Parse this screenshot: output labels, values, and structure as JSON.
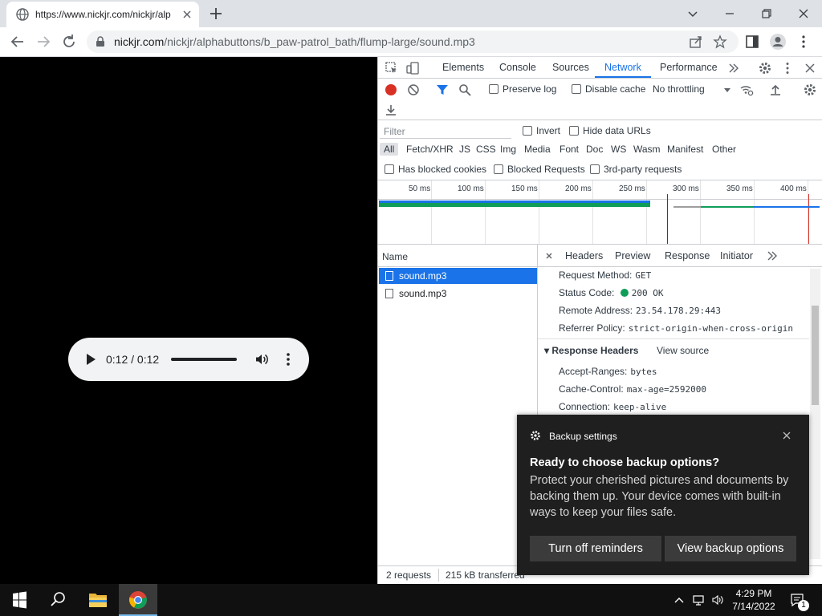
{
  "browser": {
    "tab_title": "https://www.nickjr.com/nickjr/alp",
    "url_host": "nickjr.com",
    "url_path": "/nickjr/alphabuttons/b_paw-patrol_bath/flump-large/sound.mp3"
  },
  "player": {
    "time": "0:12 / 0:12",
    "progress": 1.0
  },
  "devtools": {
    "tabs": [
      "Elements",
      "Console",
      "Sources",
      "Network",
      "Performance"
    ],
    "active_tab": "Network",
    "toolbar": {
      "preserve_log": "Preserve log",
      "disable_cache": "Disable cache",
      "throttling": "No throttling"
    },
    "filter": {
      "placeholder": "Filter",
      "invert": "Invert",
      "hide_data_urls": "Hide data URLs",
      "types": [
        "All",
        "Fetch/XHR",
        "JS",
        "CSS",
        "Img",
        "Media",
        "Font",
        "Doc",
        "WS",
        "Wasm",
        "Manifest",
        "Other"
      ],
      "has_blocked_cookies": "Has blocked cookies",
      "blocked_requests": "Blocked Requests",
      "third_party": "3rd-party requests"
    },
    "overview_ticks": [
      "50 ms",
      "100 ms",
      "150 ms",
      "200 ms",
      "250 ms",
      "300 ms",
      "350 ms",
      "400 ms"
    ],
    "requests": {
      "column": "Name",
      "rows": [
        "sound.mp3",
        "sound.mp3"
      ]
    },
    "details": {
      "tabs": [
        "Headers",
        "Preview",
        "Response",
        "Initiator"
      ],
      "request_method_key": "Request Method:",
      "request_method": "GET",
      "status_code_key": "Status Code:",
      "status_code": "200 OK",
      "remote_address_key": "Remote Address:",
      "remote_address": "23.54.178.29:443",
      "referrer_policy_key": "Referrer Policy:",
      "referrer_policy": "strict-origin-when-cross-origin",
      "response_headers": "Response Headers",
      "view_source": "View source",
      "accept_ranges_key": "Accept-Ranges:",
      "accept_ranges": "bytes",
      "cache_control_key": "Cache-Control:",
      "cache_control": "max-age=2592000",
      "connection_key": "Connection:",
      "connection": "keep-alive"
    },
    "status": {
      "requests": "2 requests",
      "transferred": "215 kB transferred"
    }
  },
  "toast": {
    "app": "Backup settings",
    "title": "Ready to choose backup options?",
    "body": "Protect your cherished pictures and documents by backing them up. Your device comes with built-in ways to keep your files safe.",
    "btn_off": "Turn off reminders",
    "btn_view": "View backup options"
  },
  "taskbar": {
    "time": "4:29 PM",
    "date": "7/14/2022",
    "notifications": "1"
  },
  "colors": {
    "accent": "#1a73e8",
    "record": "#d93025",
    "status_ok": "#0f9d58"
  }
}
